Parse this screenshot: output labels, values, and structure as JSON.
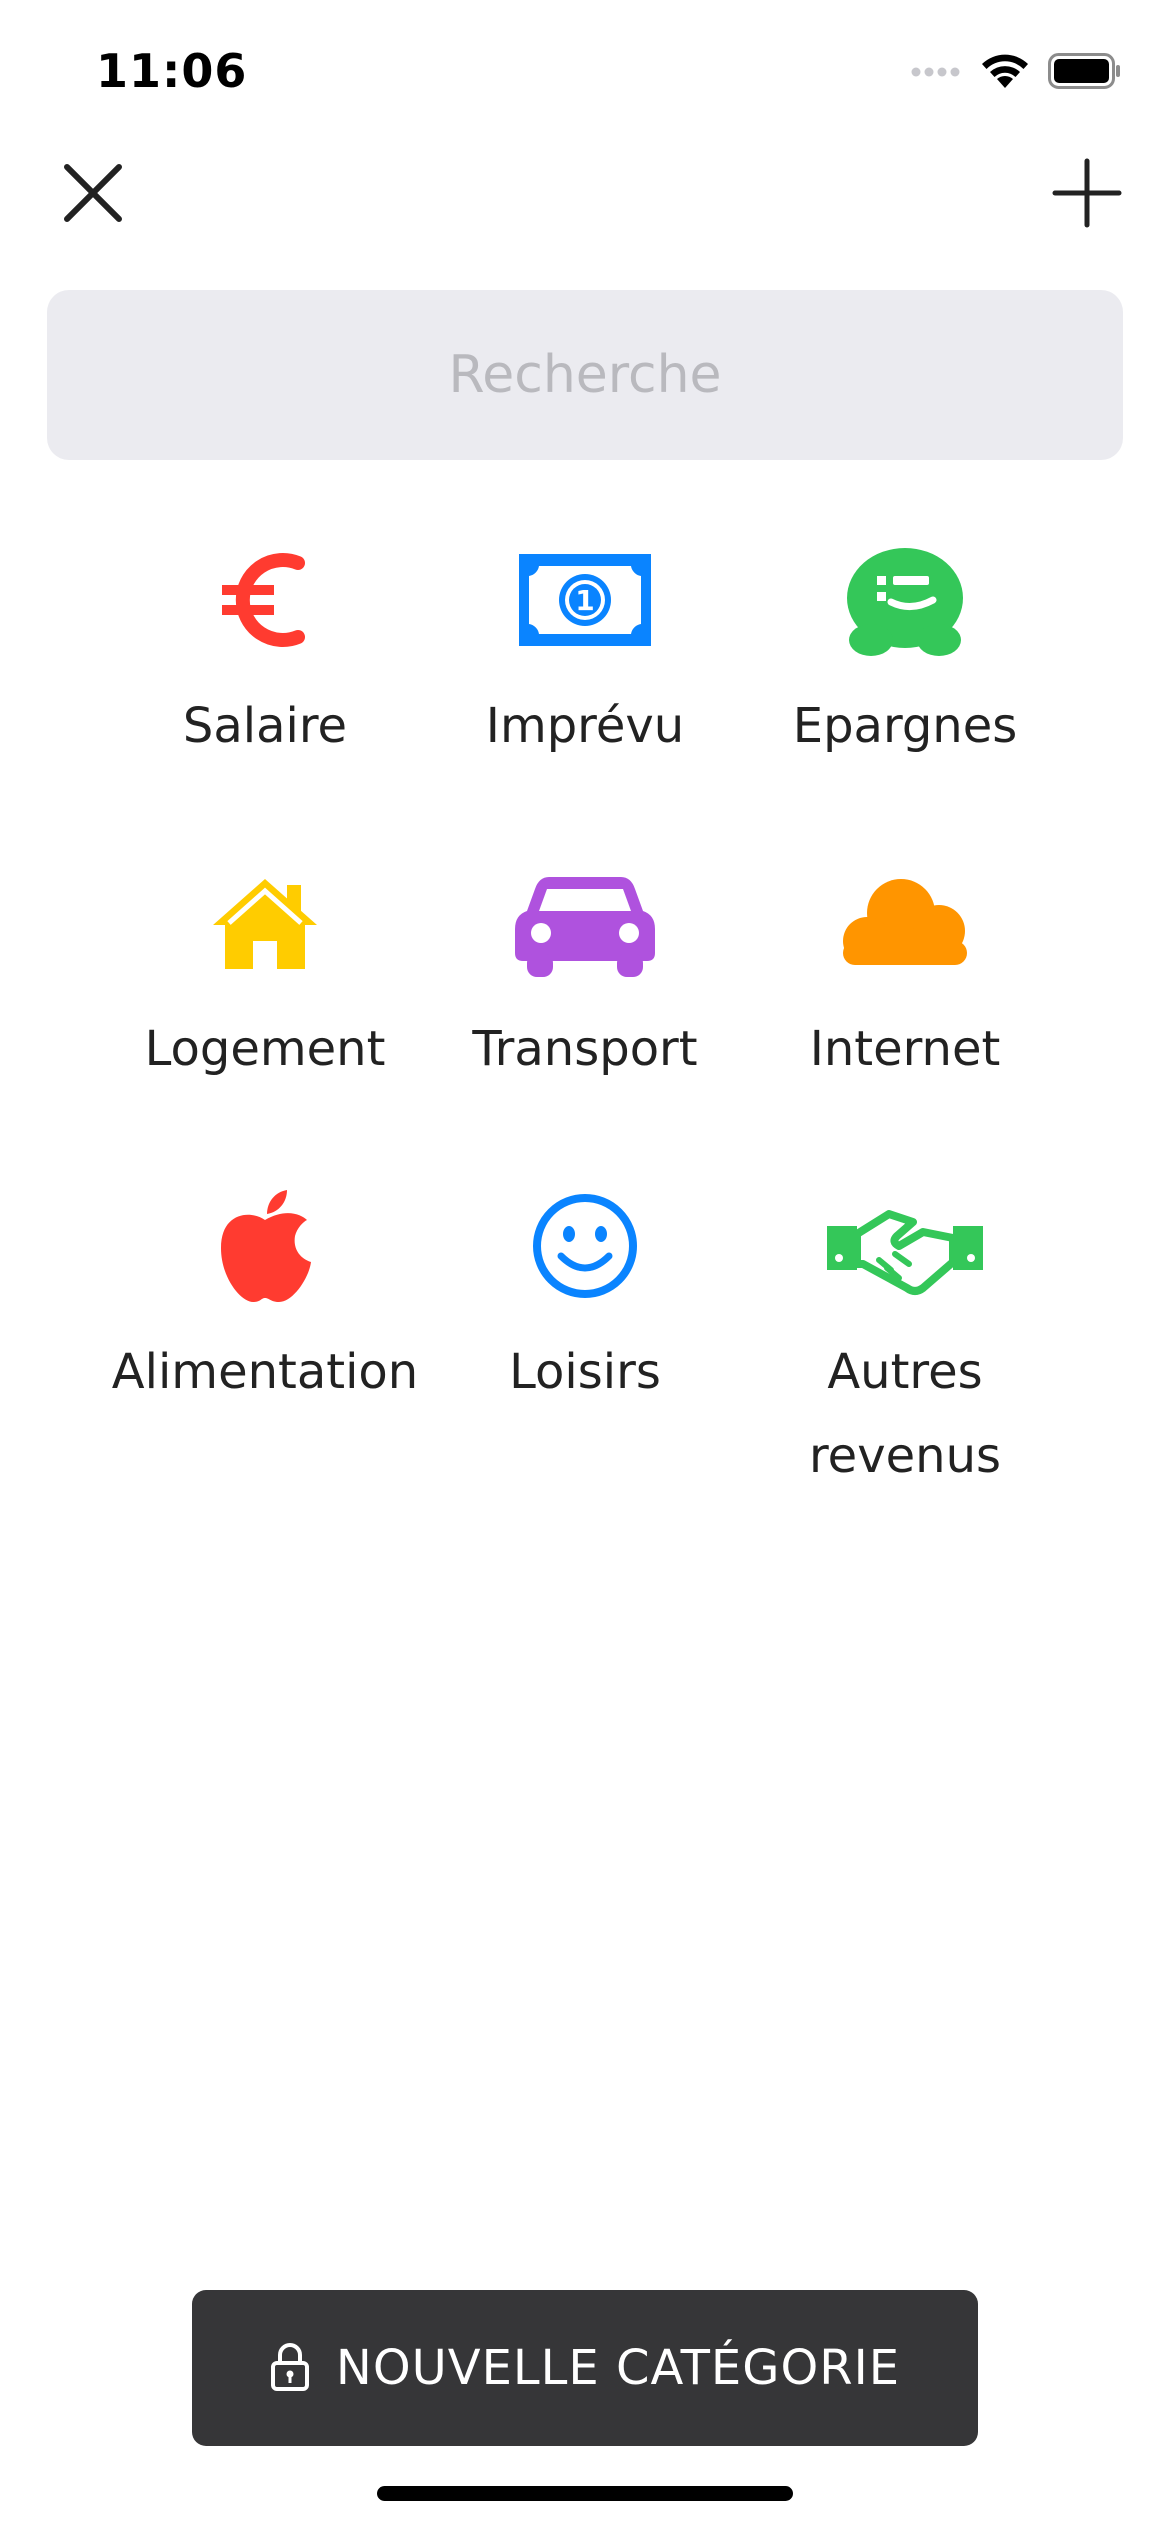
{
  "status_bar": {
    "time": "11:06",
    "icons": [
      "signal-icon",
      "wifi-icon",
      "battery-icon"
    ]
  },
  "nav": {
    "close_icon": "close-icon",
    "add_icon": "plus-icon"
  },
  "search": {
    "placeholder": "Recherche",
    "value": ""
  },
  "categories": [
    {
      "label": "Salaire",
      "icon": "euro-icon",
      "color": "#ff3b30"
    },
    {
      "label": "Imprévu",
      "icon": "banknote-icon",
      "color": "#0a84ff"
    },
    {
      "label": "Epargnes",
      "icon": "piggy-icon",
      "color": "#34c759"
    },
    {
      "label": "Logement",
      "icon": "house-icon",
      "color": "#ffcc00"
    },
    {
      "label": "Transport",
      "icon": "car-icon",
      "color": "#af52de"
    },
    {
      "label": "Internet",
      "icon": "cloud-icon",
      "color": "#ff9500"
    },
    {
      "label": "Alimentation",
      "icon": "apple-icon",
      "color": "#ff3b30"
    },
    {
      "label": "Loisirs",
      "icon": "smiley-icon",
      "color": "#0a84ff"
    },
    {
      "label": "Autres revenus",
      "icon": "handshake-icon",
      "color": "#34c759"
    }
  ],
  "footer": {
    "button_label": "NOUVELLE CATÉGORIE",
    "button_icon": "lock-icon",
    "button_color": "#363638"
  }
}
